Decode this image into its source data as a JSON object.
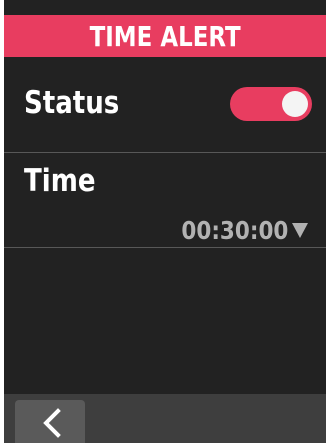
{
  "header": {
    "title": "TIME ALERT",
    "color": "#e83d60"
  },
  "status": {
    "label": "Status",
    "toggle_on": true,
    "toggle_color": "#e83d60"
  },
  "time": {
    "label": "Time",
    "value": "00:30:00",
    "dropdown_icon": "triangle-down-icon"
  },
  "footer": {
    "back_icon": "chevron-left-icon"
  },
  "colors": {
    "background": "#222222",
    "footer": "#3e3e3e",
    "back_button": "#5a5a5a",
    "value_text": "#b2b2b2"
  }
}
